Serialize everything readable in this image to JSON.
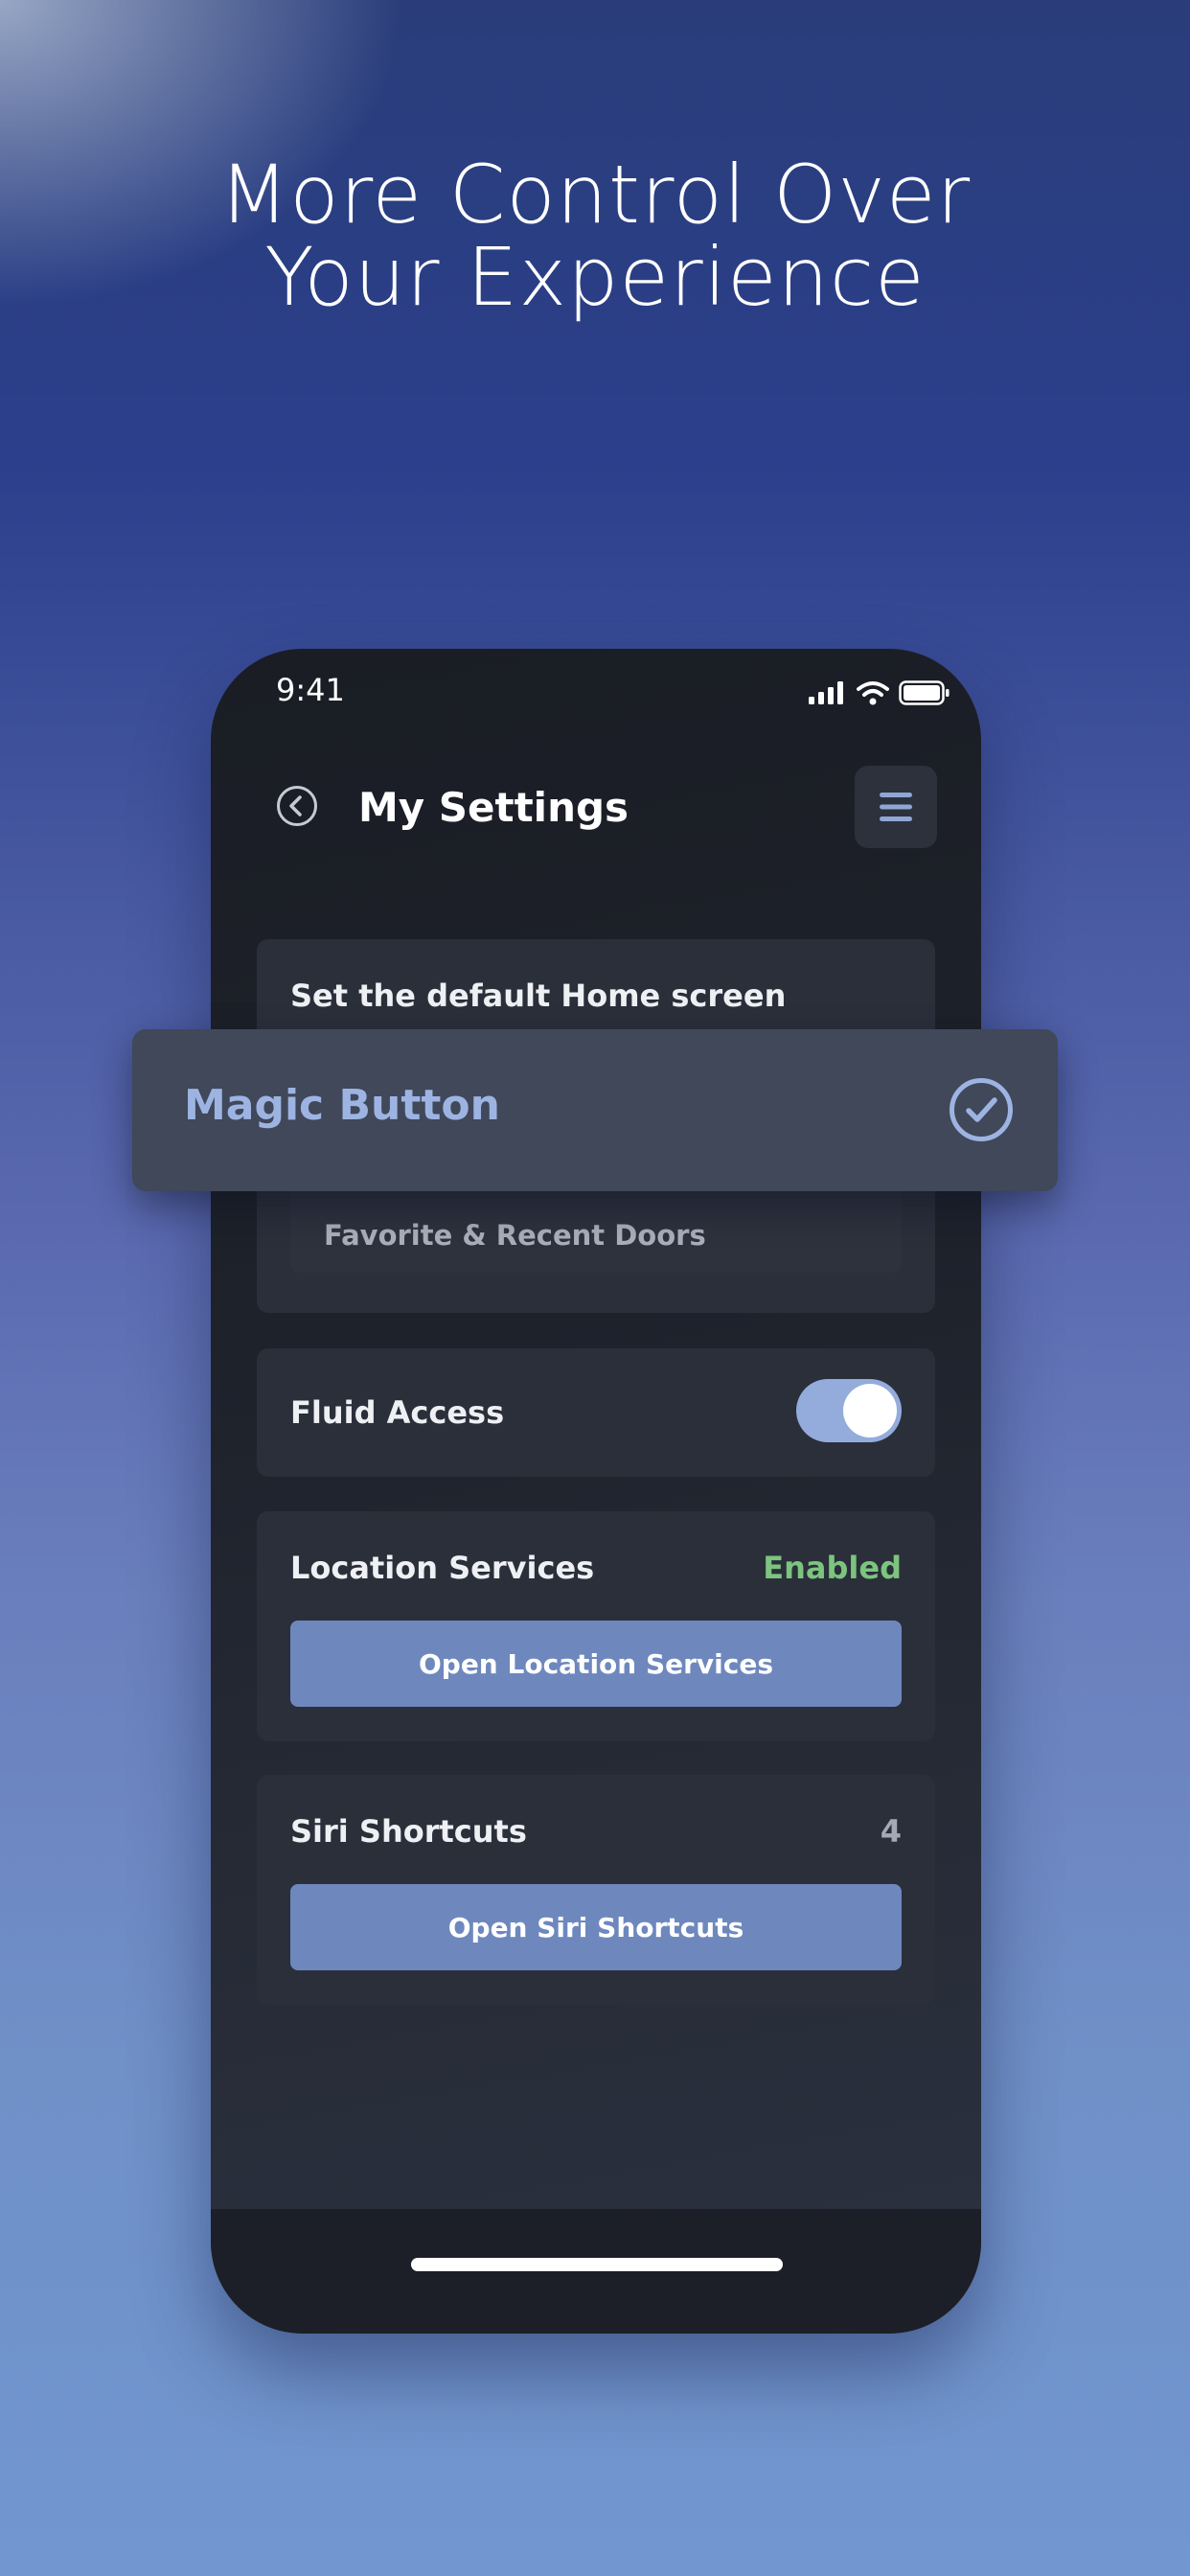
{
  "headline": {
    "line1": "More Control Over",
    "line2": "Your Experience"
  },
  "status_bar": {
    "time": "9:41",
    "icons": [
      "cellular-signal-icon",
      "wifi-icon",
      "battery-icon"
    ]
  },
  "header": {
    "back_icon": "back-circle-chevron-icon",
    "title": "My Settings",
    "menu_icon": "hamburger-menu-icon"
  },
  "home_screen_setting": {
    "label": "Set the default Home screen",
    "selected_option": "Magic Button",
    "selected_icon": "check-circle-icon",
    "other_option": "Favorite & Recent Doors"
  },
  "fluid_access": {
    "label": "Fluid Access",
    "enabled": true
  },
  "location_services": {
    "label": "Location Services",
    "status": "Enabled",
    "button_label": "Open Location Services"
  },
  "siri_shortcuts": {
    "label": "Siri Shortcuts",
    "count": "4",
    "button_label": "Open Siri Shortcuts"
  },
  "colors": {
    "accent": "#6e88be",
    "toggle_on": "#93acdc",
    "status_enabled": "#7cc47f",
    "magic_label": "#9db4e3"
  }
}
